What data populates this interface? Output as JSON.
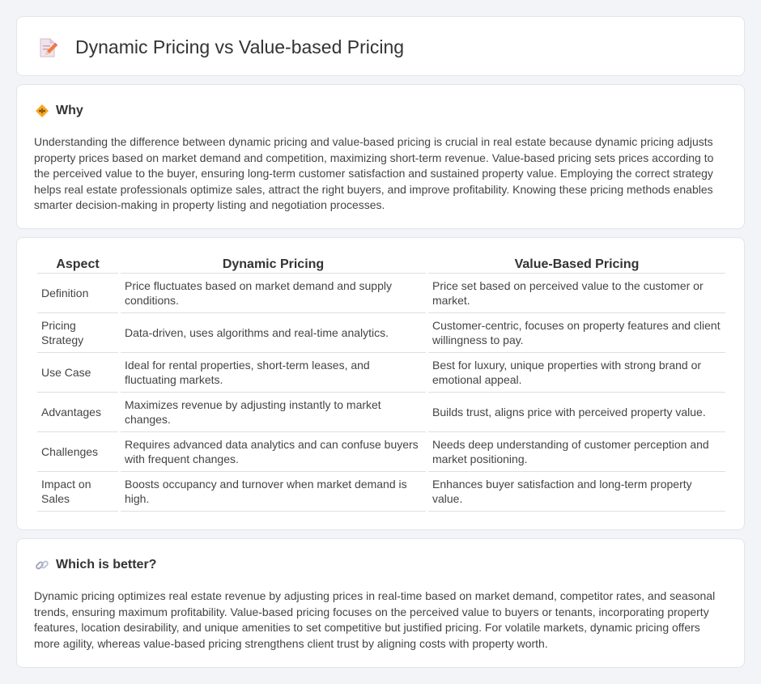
{
  "header": {
    "title": "Dynamic Pricing vs Value-based Pricing",
    "icon": "document-pencil-icon"
  },
  "why": {
    "title": "Why",
    "icon": "diamond-warning-icon",
    "text": "Understanding the difference between dynamic pricing and value-based pricing is crucial in real estate because dynamic pricing adjusts property prices based on market demand and competition, maximizing short-term revenue. Value-based pricing sets prices according to the perceived value to the buyer, ensuring long-term customer satisfaction and sustained property value. Employing the correct strategy helps real estate professionals optimize sales, attract the right buyers, and improve profitability. Knowing these pricing methods enables smarter decision-making in property listing and negotiation processes."
  },
  "comparison": {
    "headers": [
      "Aspect",
      "Dynamic Pricing",
      "Value-Based Pricing"
    ],
    "rows": [
      {
        "aspect": "Definition",
        "dynamic": "Price fluctuates based on market demand and supply conditions.",
        "value": "Price set based on perceived value to the customer or market."
      },
      {
        "aspect": "Pricing Strategy",
        "dynamic": "Data-driven, uses algorithms and real-time analytics.",
        "value": "Customer-centric, focuses on property features and client willingness to pay."
      },
      {
        "aspect": "Use Case",
        "dynamic": "Ideal for rental properties, short-term leases, and fluctuating markets.",
        "value": "Best for luxury, unique properties with strong brand or emotional appeal."
      },
      {
        "aspect": "Advantages",
        "dynamic": "Maximizes revenue by adjusting instantly to market changes.",
        "value": "Builds trust, aligns price with perceived property value."
      },
      {
        "aspect": "Challenges",
        "dynamic": "Requires advanced data analytics and can confuse buyers with frequent changes.",
        "value": "Needs deep understanding of customer perception and market positioning."
      },
      {
        "aspect": "Impact on Sales",
        "dynamic": "Boosts occupancy and turnover when market demand is high.",
        "value": "Enhances buyer satisfaction and long-term property value."
      }
    ]
  },
  "better": {
    "title": "Which is better?",
    "icon": "link-icon",
    "text": "Dynamic pricing optimizes real estate revenue by adjusting prices in real-time based on market demand, competitor rates, and seasonal trends, ensuring maximum profitability. Value-based pricing focuses on the perceived value to buyers or tenants, incorporating property features, location desirability, and unique amenities to set competitive but justified pricing. For volatile markets, dynamic pricing offers more agility, whereas value-based pricing strengthens client trust by aligning costs with property worth."
  }
}
